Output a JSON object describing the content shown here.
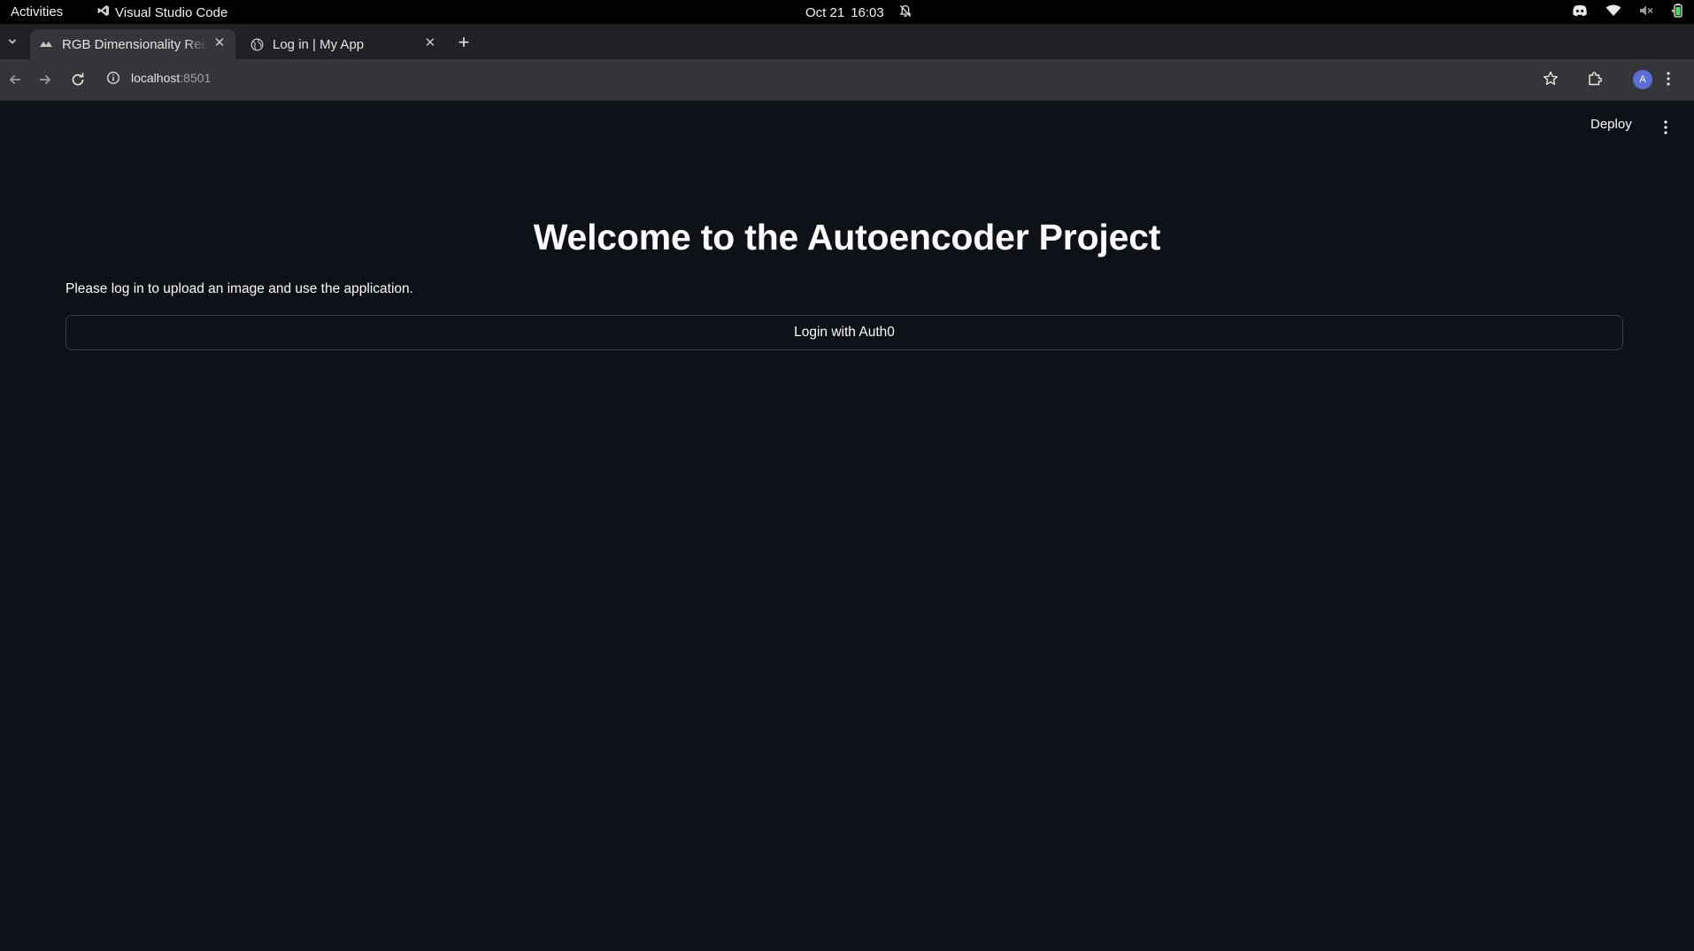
{
  "topbar": {
    "activities": "Activities",
    "app_name": "Visual Studio Code",
    "date": "Oct 21",
    "time": "16:03"
  },
  "tabs": [
    {
      "title": "RGB Dimensionality Reduction",
      "active": true
    },
    {
      "title": "Log in | My App",
      "active": false
    }
  ],
  "address_bar": {
    "host": "localhost",
    "port": ":8501"
  },
  "profile": {
    "initial": "A"
  },
  "app": {
    "deploy_label": "Deploy",
    "heading": "Welcome to the Autoencoder Project",
    "subtext": "Please log in to upload an image and use the application.",
    "login_button": "Login with Auth0"
  },
  "colors": {
    "app_background": "#0e1117",
    "text": "#fafafa",
    "tab_strip": "#202124",
    "toolbar": "#35363a",
    "avatar": "#5b6dd6"
  }
}
